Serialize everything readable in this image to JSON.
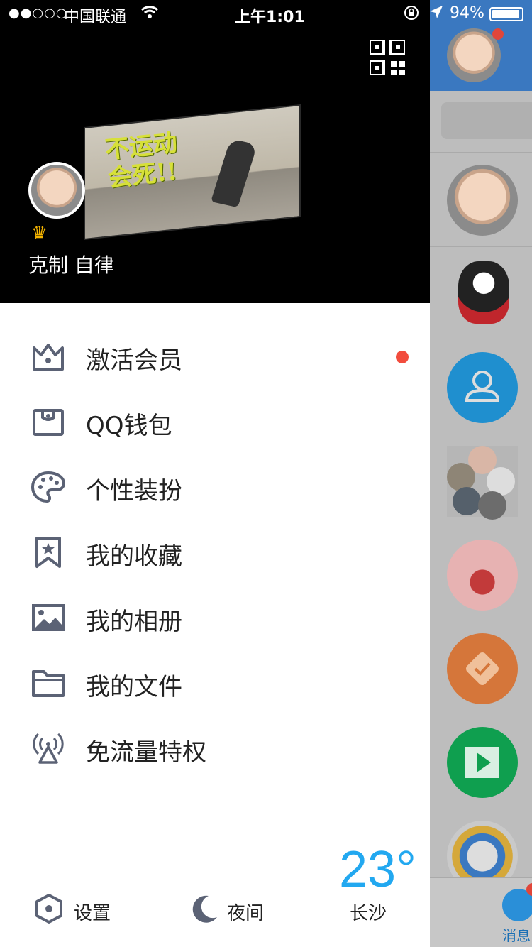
{
  "status_bar": {
    "signal": "●●○○○",
    "carrier": "中国联通",
    "time": "上午1:01",
    "battery": "94%"
  },
  "profile": {
    "banner_text": "不运动 会死!!",
    "nickname": "克制  自律",
    "vip_icon": "crown-icon"
  },
  "menu": {
    "items": [
      {
        "label": "激活会员",
        "icon": "crown-outline-icon",
        "badge": true
      },
      {
        "label": "QQ钱包",
        "icon": "wallet-icon"
      },
      {
        "label": "个性装扮",
        "icon": "palette-icon"
      },
      {
        "label": "我的收藏",
        "icon": "bookmark-star-icon"
      },
      {
        "label": "我的相册",
        "icon": "photo-icon"
      },
      {
        "label": "我的文件",
        "icon": "folder-icon"
      },
      {
        "label": "免流量特权",
        "icon": "broadcast-tower-icon"
      }
    ]
  },
  "footer": {
    "settings_label": "设置",
    "night_label": "夜间",
    "temperature": "23°",
    "city": "长沙"
  },
  "background": {
    "tab_label": "消息"
  },
  "colors": {
    "header_bg": "#000000",
    "icon": "#5b6275",
    "badge_red": "#f24c3d",
    "weather_blue": "#22a8f0"
  }
}
